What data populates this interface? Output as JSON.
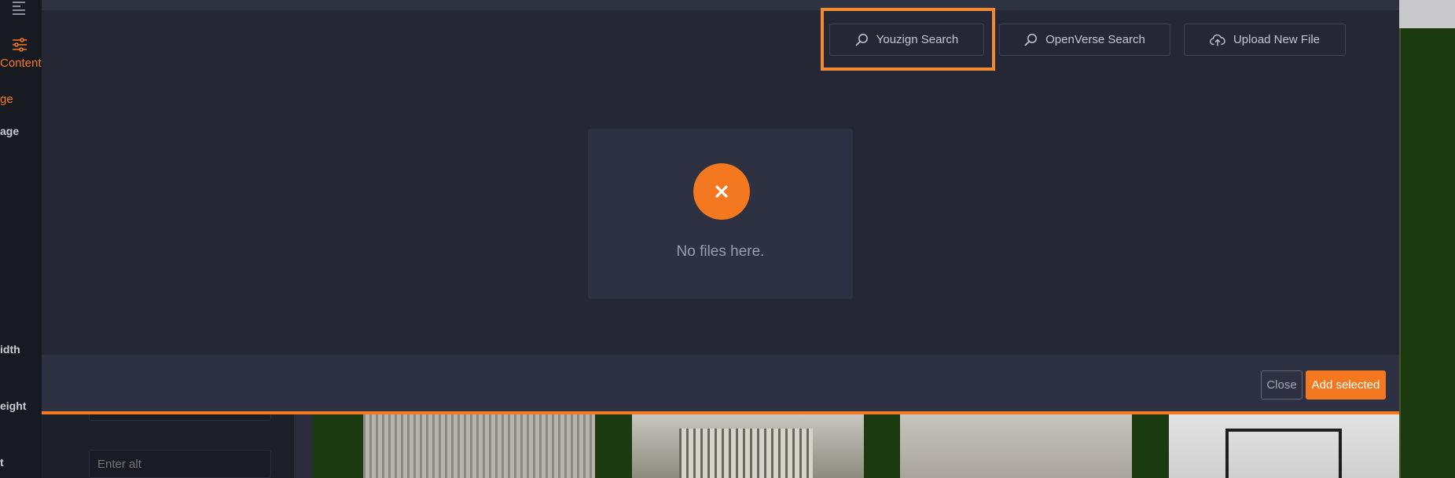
{
  "editor": {
    "tab_label": "Content",
    "section_label": "ge",
    "field_image": "age",
    "field_width": "idth",
    "field_height": "eight",
    "field_alt": "t",
    "alt_placeholder": "Enter alt"
  },
  "modal": {
    "youzign_label": "Youzign Search",
    "openverse_label": "OpenVerse Search",
    "upload_label": "Upload New File",
    "empty_message": "No files here.",
    "close_label": "Close",
    "add_selected_label": "Add selected"
  },
  "icons": {
    "search": "search-icon",
    "upload": "cloud-upload-icon",
    "empty": "close-icon",
    "menu": "menu-icon",
    "sliders": "sliders-icon"
  },
  "colors": {
    "accent": "#f47820",
    "modal_bg": "#252834",
    "footer_bg": "#2e3141"
  }
}
